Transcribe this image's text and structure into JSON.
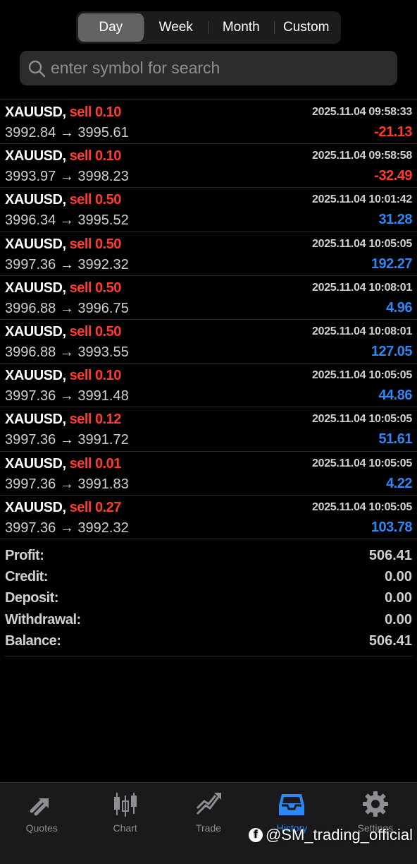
{
  "period_tabs": [
    {
      "label": "Day",
      "active": true
    },
    {
      "label": "Week",
      "active": false
    },
    {
      "label": "Month",
      "active": false
    },
    {
      "label": "Custom",
      "active": false
    }
  ],
  "search": {
    "placeholder": "enter symbol for search"
  },
  "deals": [
    {
      "symbol": "XAUUSD,",
      "side": "sell 0.10",
      "time": "2025.11.04 09:58:33",
      "prices": "3992.84 → 3995.61",
      "profit": "-21.13",
      "sign": "neg"
    },
    {
      "symbol": "XAUUSD,",
      "side": "sell 0.10",
      "time": "2025.11.04 09:58:58",
      "prices": "3993.97 → 3998.23",
      "profit": "-32.49",
      "sign": "neg"
    },
    {
      "symbol": "XAUUSD,",
      "side": "sell 0.50",
      "time": "2025.11.04 10:01:42",
      "prices": "3996.34 → 3995.52",
      "profit": "31.28",
      "sign": "pos"
    },
    {
      "symbol": "XAUUSD,",
      "side": "sell 0.50",
      "time": "2025.11.04 10:05:05",
      "prices": "3997.36 → 3992.32",
      "profit": "192.27",
      "sign": "pos"
    },
    {
      "symbol": "XAUUSD,",
      "side": "sell 0.50",
      "time": "2025.11.04 10:08:01",
      "prices": "3996.88 → 3996.75",
      "profit": "4.96",
      "sign": "pos"
    },
    {
      "symbol": "XAUUSD,",
      "side": "sell 0.50",
      "time": "2025.11.04 10:08:01",
      "prices": "3996.88 → 3993.55",
      "profit": "127.05",
      "sign": "pos"
    },
    {
      "symbol": "XAUUSD,",
      "side": "sell 0.10",
      "time": "2025.11.04 10:05:05",
      "prices": "3997.36 → 3991.48",
      "profit": "44.86",
      "sign": "pos"
    },
    {
      "symbol": "XAUUSD,",
      "side": "sell 0.12",
      "time": "2025.11.04 10:05:05",
      "prices": "3997.36 → 3991.72",
      "profit": "51.61",
      "sign": "pos"
    },
    {
      "symbol": "XAUUSD,",
      "side": "sell 0.01",
      "time": "2025.11.04 10:05:05",
      "prices": "3997.36 → 3991.83",
      "profit": "4.22",
      "sign": "pos"
    },
    {
      "symbol": "XAUUSD,",
      "side": "sell 0.27",
      "time": "2025.11.04 10:05:05",
      "prices": "3997.36 → 3992.32",
      "profit": "103.78",
      "sign": "pos"
    }
  ],
  "summary": [
    {
      "label": "Profit:",
      "value": "506.41"
    },
    {
      "label": "Credit:",
      "value": "0.00"
    },
    {
      "label": "Deposit:",
      "value": "0.00"
    },
    {
      "label": "Withdrawal:",
      "value": "0.00"
    },
    {
      "label": "Balance:",
      "value": "506.41"
    }
  ],
  "tabbar": [
    {
      "label": "Quotes",
      "icon": "quotes-icon",
      "active": false
    },
    {
      "label": "Chart",
      "icon": "chart-icon",
      "active": false
    },
    {
      "label": "Trade",
      "icon": "trade-icon",
      "active": false
    },
    {
      "label": "History",
      "icon": "history-icon",
      "active": true
    },
    {
      "label": "Settings",
      "icon": "settings-icon",
      "active": false
    }
  ],
  "colors": {
    "loss": "#ff3b30",
    "gain": "#2f86f5",
    "accent": "#2f86f5"
  },
  "watermark": {
    "text": "@SM_trading_official",
    "icon": "facebook-icon",
    "glyph": "f"
  }
}
